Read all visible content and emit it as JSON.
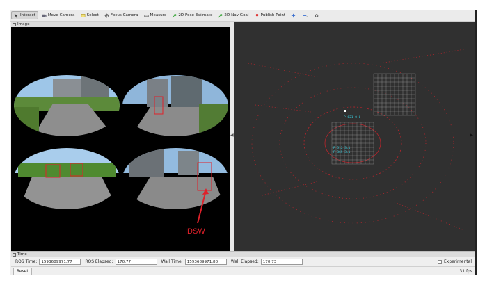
{
  "toolbar": {
    "items": [
      {
        "label": "Interact",
        "icon": "interact-icon",
        "active": true
      },
      {
        "label": "Move Camera",
        "icon": "move-camera-icon"
      },
      {
        "label": "Select",
        "icon": "select-icon"
      },
      {
        "label": "Focus Camera",
        "icon": "focus-camera-icon"
      },
      {
        "label": "Measure",
        "icon": "measure-icon"
      },
      {
        "label": "2D Pose Estimate",
        "icon": "pose-estimate-icon"
      },
      {
        "label": "2D Nav Goal",
        "icon": "nav-goal-icon"
      },
      {
        "label": "Publish Point",
        "icon": "publish-point-icon"
      }
    ]
  },
  "image_panel": {
    "title": "Image",
    "annotation": "IDSW"
  },
  "time_panel": {
    "title": "Time",
    "ros_time_label": "ROS Time:",
    "ros_time_value": "1593689971.77",
    "ros_elapsed_label": "ROS Elapsed:",
    "ros_elapsed_value": "170.77",
    "wall_time_label": "Wall Time:",
    "wall_time_value": "1593689971.80",
    "wall_elapsed_label": "Wall Elapsed:",
    "wall_elapsed_value": "170.73",
    "experimental_label": "Experimental"
  },
  "status": {
    "reset_label": "Reset",
    "fps": "31 fps"
  },
  "viewport_labels": [
    "P 621 0.0",
    "P 512 3.1",
    "P 365 3.1"
  ],
  "colors": {
    "accent_red": "#e0202a",
    "grid": "#9a9a9a",
    "label_cyan": "#3ad0e0"
  }
}
